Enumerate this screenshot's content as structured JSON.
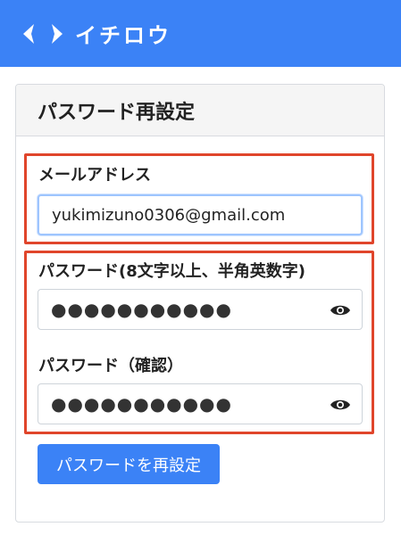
{
  "header": {
    "brand": "イチロウ",
    "logo_icon": "chevron-logo-icon"
  },
  "card": {
    "title": "パスワード再設定"
  },
  "form": {
    "email_label": "メールアドレス",
    "email_value": "yukimizuno0306@gmail.com",
    "password_label": "パスワード(8文字以上、半角英数字)",
    "password_value": "●●●●●●●●●●●",
    "password_confirm_label": "パスワード（確認）",
    "password_confirm_value": "●●●●●●●●●●●",
    "eye_icon": "eye-icon"
  },
  "submit_label": "パスワードを再設定",
  "colors": {
    "brand_blue": "#3b82f6",
    "highlight_red": "#e0452b"
  }
}
